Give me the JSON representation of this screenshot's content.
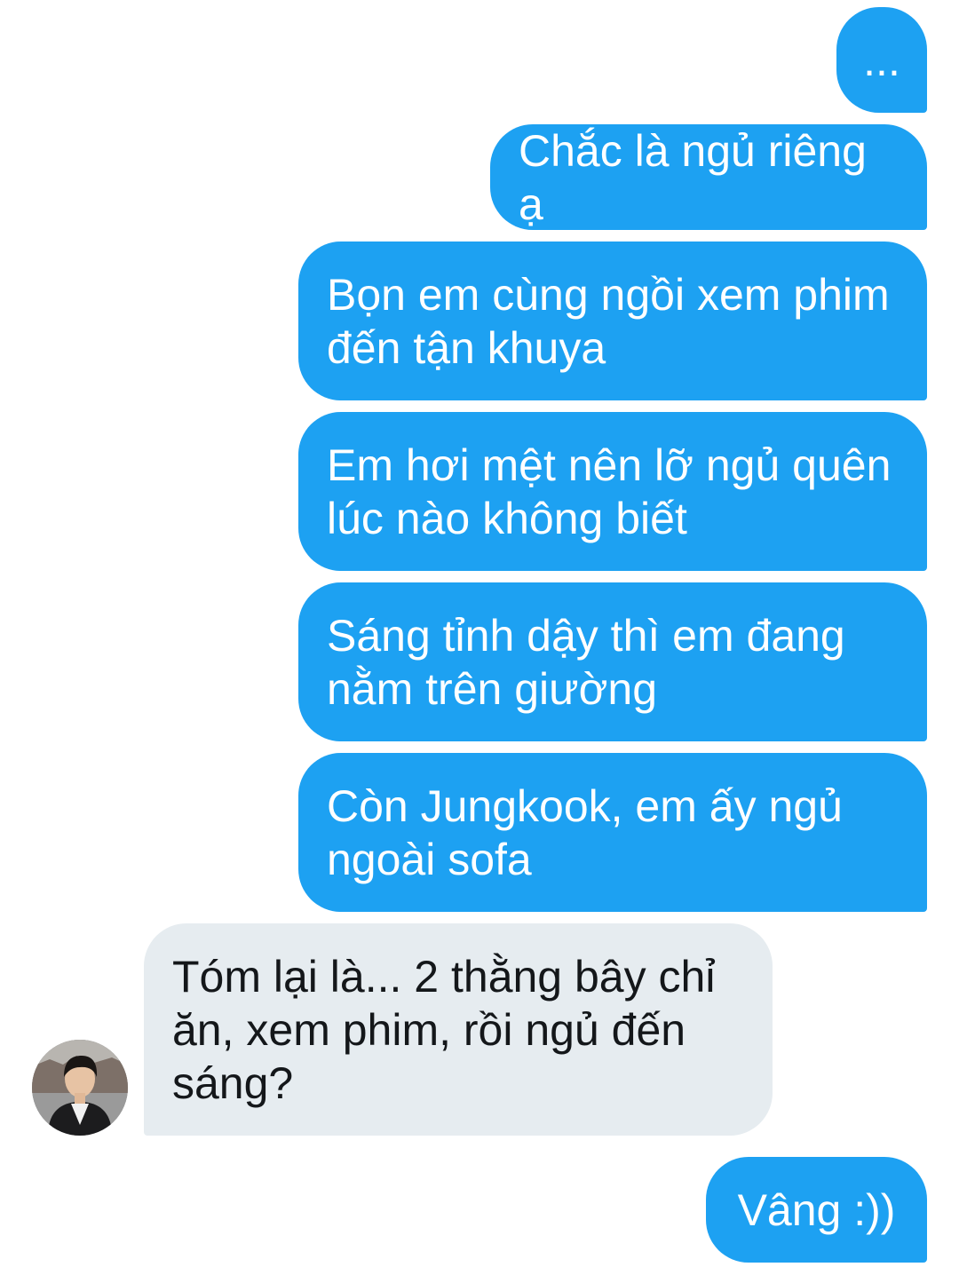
{
  "conversation": {
    "messages": [
      {
        "id": "m1",
        "sender": "me",
        "text": "..."
      },
      {
        "id": "m2",
        "sender": "me",
        "text": "Chắc là ngủ riêng ạ"
      },
      {
        "id": "m3",
        "sender": "me",
        "text": "Bọn em cùng ngồi xem phim\nđến tận khuya"
      },
      {
        "id": "m4",
        "sender": "me",
        "text": "Em hơi mệt nên lỡ ngủ quên\nlúc nào không biết"
      },
      {
        "id": "m5",
        "sender": "me",
        "text": "Sáng tỉnh dậy thì em đang\nnằm trên giường"
      },
      {
        "id": "m6",
        "sender": "me",
        "text": "Còn Jungkook, em ấy ngủ\nngoài sofa"
      },
      {
        "id": "m7",
        "sender": "other",
        "text": "Tóm lại là... 2 thằng bây chỉ\năn, xem phim, rồi ngủ đến\nsáng?"
      },
      {
        "id": "m8",
        "sender": "me",
        "text": "Vâng :))"
      }
    ]
  },
  "colors": {
    "sent_bubble": "#1da1f2",
    "sent_text": "#ffffff",
    "received_bubble": "#e6ecf0",
    "received_text": "#14171a",
    "background": "#ffffff"
  },
  "icons": {
    "avatar": "user-avatar-photo"
  }
}
